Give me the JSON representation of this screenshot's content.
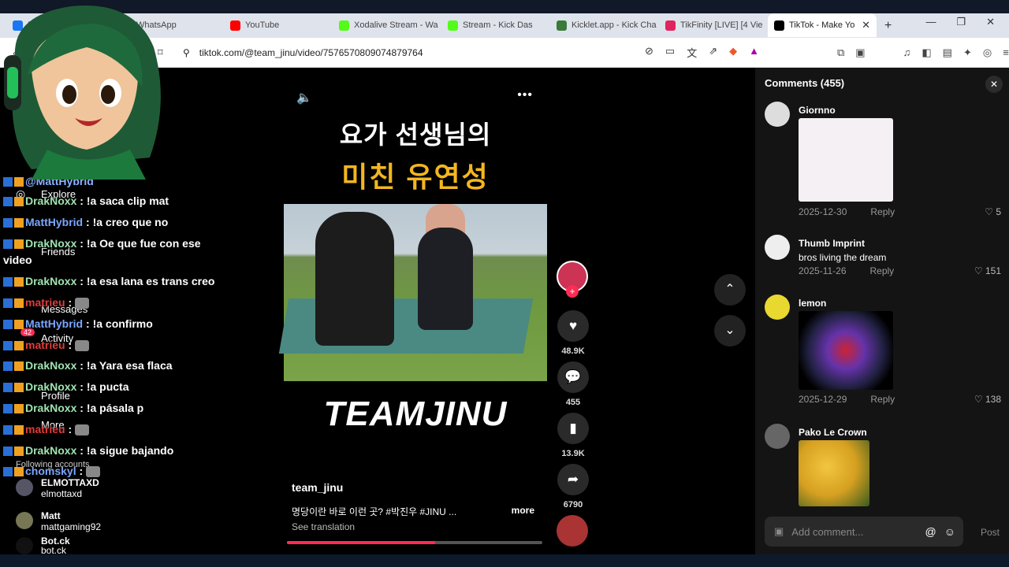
{
  "tabs": [
    {
      "label": "Fa...",
      "color": "#1877f2"
    },
    {
      "label": "WhatsApp",
      "color": "#25d366"
    },
    {
      "label": "YouTube",
      "color": "#ff0000"
    },
    {
      "label": "Xodalive Stream - Wa",
      "color": "#53fc18"
    },
    {
      "label": "Stream - Kick Das",
      "color": "#53fc18"
    },
    {
      "label": "Kicklet.app - Kick Cha",
      "color": "#3a7a3a"
    },
    {
      "label": "TikFinity [LIVE] [4 Vie",
      "color": "#e0245e"
    },
    {
      "label": "TikTok - Make Yo",
      "color": "#000000"
    }
  ],
  "url": "tiktok.com/@team_jinu/video/7576570809074879764",
  "video": {
    "title_line1": "요가 선생님의",
    "title_line2": "미친 유연성",
    "brand": "TEAMJINU",
    "username": "team_jinu",
    "description": "명당이란 바로 이런 곳? #박진우 #JINU ...",
    "more": "more",
    "see_translation": "See translation",
    "progress": 0.58
  },
  "rail": {
    "likes": "48.9K",
    "comments": "455",
    "saves": "13.9K",
    "shares": "6790"
  },
  "comments_panel": {
    "title": "Comments (455)",
    "items": [
      {
        "name": "Giornno",
        "text": "",
        "date": "2025-12-30",
        "reply": "Reply",
        "likes": "5"
      },
      {
        "name": "Thumb Imprint",
        "text": "bros living the dream",
        "date": "2025-11-26",
        "reply": "Reply",
        "likes": "151"
      },
      {
        "name": "lemon",
        "text": "",
        "date": "2025-12-29",
        "reply": "Reply",
        "likes": "138"
      },
      {
        "name": "Pako Le Crown",
        "text": "",
        "date": "",
        "reply": "",
        "likes": ""
      }
    ],
    "add_placeholder": "Add comment...",
    "post": "Post"
  },
  "sidebar": {
    "explore": "Explore",
    "friends": "Friends",
    "messages": "Messages",
    "activity": "Activity",
    "activity_badge": "42",
    "profile": "Profile",
    "more": "More",
    "following": "Following accounts"
  },
  "following": [
    {
      "name": "ELMOTTAXD",
      "handle": "elmottaxd"
    },
    {
      "name": "Matt",
      "handle": "mattgaming92"
    },
    {
      "name": "Bot.ck",
      "handle": "bot.ck"
    }
  ],
  "chat": [
    {
      "user": "@MattHybrid",
      "msg": "",
      "cls": "u4"
    },
    {
      "user": "DrakNoxx",
      "msg": ": !a saca clip mat",
      "cls": "u1"
    },
    {
      "user": "MattHybrid",
      "msg": ": !a creo que no",
      "cls": "u2"
    },
    {
      "user": "DrakNoxx",
      "msg": ": !a Oe que fue con ese",
      "cls": "u1"
    },
    {
      "user": "video",
      "msg": "",
      "cls": ""
    },
    {
      "user": "DrakNoxx",
      "msg": ": !a esa lana es trans creo",
      "cls": "u1"
    },
    {
      "user": "matrieu",
      "msg": ":",
      "cls": "u3"
    },
    {
      "user": "MattHybrid",
      "msg": ": !a confirmo",
      "cls": "u2"
    },
    {
      "user": "matrieu",
      "msg": ":",
      "cls": "u3"
    },
    {
      "user": "DrakNoxx",
      "msg": ": !a Yara esa flaca",
      "cls": "u1"
    },
    {
      "user": "DrakNoxx",
      "msg": ": !a pucta",
      "cls": "u1"
    },
    {
      "user": "DrakNoxx",
      "msg": ": !a pásala p",
      "cls": "u1"
    },
    {
      "user": "matrieu",
      "msg": ":",
      "cls": "u3"
    },
    {
      "user": "DrakNoxx",
      "msg": ": !a sigue bajando",
      "cls": "u1"
    },
    {
      "user": "chomskyl",
      "msg": ":",
      "cls": "u2"
    }
  ]
}
